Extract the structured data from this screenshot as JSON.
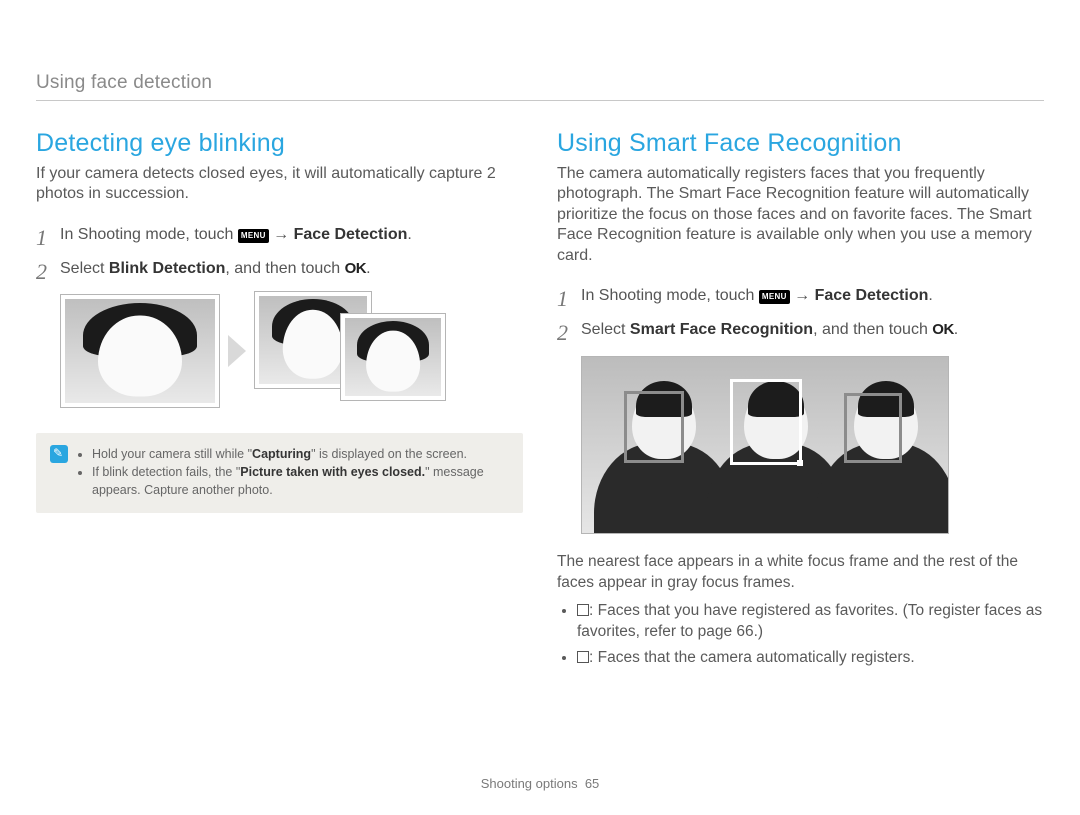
{
  "running_head": "Using face detection",
  "footer": {
    "section": "Shooting options",
    "page": "65"
  },
  "left": {
    "title": "Detecting eye blinking",
    "intro": "If your camera detects closed eyes, it will automatically capture 2 photos in succession.",
    "step1_a": "In Shooting mode, touch ",
    "step1_menu": "MENU",
    "step1_b": " → ",
    "step1_c": "Face Detection",
    "step1_d": ".",
    "step2_a": "Select ",
    "step2_b": "Blink Detection",
    "step2_c": ", and then touch ",
    "step2_ok": "OK",
    "step2_d": ".",
    "note1_a": "Hold your camera still while \"",
    "note1_b": "Capturing",
    "note1_c": "\" is displayed on the screen.",
    "note2_a": "If blink detection fails, the \"",
    "note2_b": "Picture taken with eyes closed.",
    "note2_c": "\" message appears. Capture another photo."
  },
  "right": {
    "title": "Using Smart Face Recognition",
    "intro": "The camera automatically registers faces that you frequently photograph. The Smart Face Recognition feature will automatically prioritize the focus on those faces and on favorite faces. The Smart Face Recognition feature is available only when you use a memory card.",
    "step1_a": "In Shooting mode, touch ",
    "step1_menu": "MENU",
    "step1_b": " → ",
    "step1_c": "Face Detection",
    "step1_d": ".",
    "step2_a": "Select ",
    "step2_b": "Smart Face Recognition",
    "step2_c": ", and then touch ",
    "step2_ok": "OK",
    "step2_d": ".",
    "foot_p": "The nearest face appears in a white focus frame and the rest of the faces appear in gray focus frames.",
    "foot_li1": ": Faces that you have registered as favorites. (To register faces as favorites, refer to page 66.)",
    "foot_li2": ": Faces that the camera automatically registers."
  }
}
